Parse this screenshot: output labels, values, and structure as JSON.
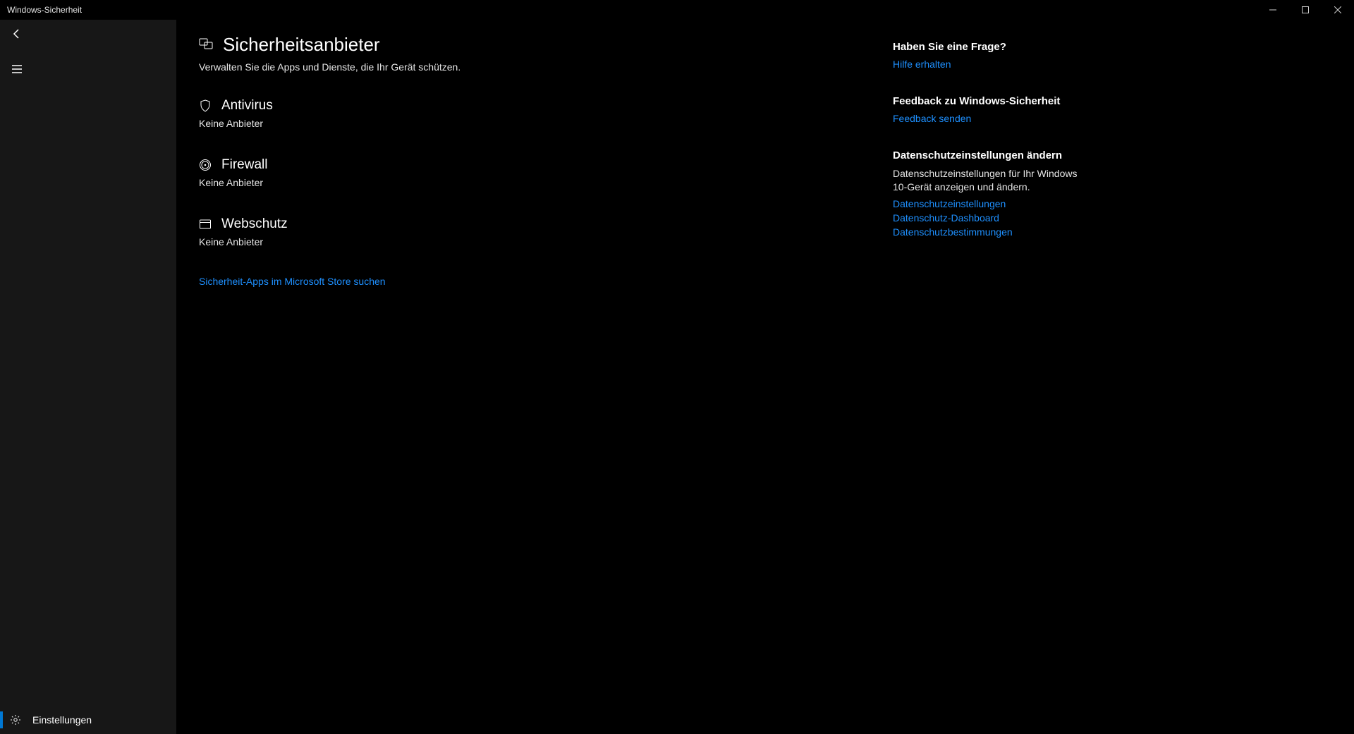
{
  "window": {
    "title": "Windows-Sicherheit"
  },
  "sidebar": {
    "settings_label": "Einstellungen"
  },
  "page": {
    "title": "Sicherheitsanbieter",
    "subtitle": "Verwalten Sie die Apps und Dienste, die Ihr Gerät schützen."
  },
  "sections": {
    "antivirus": {
      "title": "Antivirus",
      "status": "Keine Anbieter"
    },
    "firewall": {
      "title": "Firewall",
      "status": "Keine Anbieter"
    },
    "web": {
      "title": "Webschutz",
      "status": "Keine Anbieter"
    }
  },
  "store_link": "Sicherheit-Apps im Microsoft Store suchen",
  "rail": {
    "help": {
      "heading": "Haben Sie eine Frage?",
      "link": "Hilfe erhalten"
    },
    "feedback": {
      "heading": "Feedback zu Windows-Sicherheit",
      "link": "Feedback senden"
    },
    "privacy": {
      "heading": "Datenschutzeinstellungen ändern",
      "text": "Datenschutzeinstellungen für Ihr Windows 10-Gerät anzeigen und ändern.",
      "links": {
        "settings": "Datenschutzeinstellungen",
        "dashboard": "Datenschutz-Dashboard",
        "statement": "Datenschutzbestimmungen"
      }
    }
  }
}
